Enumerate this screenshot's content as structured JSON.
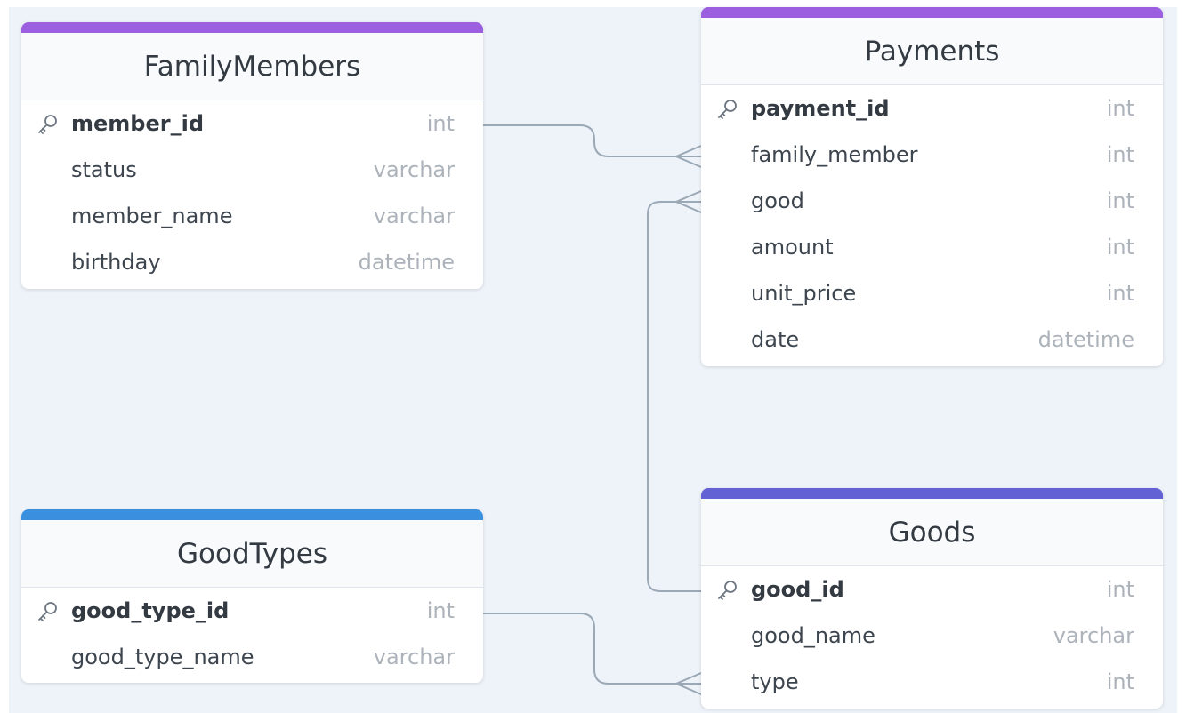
{
  "colors": {
    "family_members": "#9b5fe0",
    "payments": "#9b5fe0",
    "good_types": "#3a8fdf",
    "goods": "#6262d4",
    "edge": "#9ba8b6"
  },
  "tables": {
    "family_members": {
      "title": "FamilyMembers",
      "fields": [
        {
          "name": "member_id",
          "type": "int",
          "pk": true
        },
        {
          "name": "status",
          "type": "varchar"
        },
        {
          "name": "member_name",
          "type": "varchar"
        },
        {
          "name": "birthday",
          "type": "datetime"
        }
      ]
    },
    "payments": {
      "title": "Payments",
      "fields": [
        {
          "name": "payment_id",
          "type": "int",
          "pk": true
        },
        {
          "name": "family_member",
          "type": "int"
        },
        {
          "name": "good",
          "type": "int"
        },
        {
          "name": "amount",
          "type": "int"
        },
        {
          "name": "unit_price",
          "type": "int"
        },
        {
          "name": "date",
          "type": "datetime"
        }
      ]
    },
    "good_types": {
      "title": "GoodTypes",
      "fields": [
        {
          "name": "good_type_id",
          "type": "int",
          "pk": true
        },
        {
          "name": "good_type_name",
          "type": "varchar"
        }
      ]
    },
    "goods": {
      "title": "Goods",
      "fields": [
        {
          "name": "good_id",
          "type": "int",
          "pk": true
        },
        {
          "name": "good_name",
          "type": "varchar"
        },
        {
          "name": "type",
          "type": "int"
        }
      ]
    }
  },
  "relationships": [
    {
      "from": "FamilyMembers.member_id",
      "to": "Payments.family_member",
      "cardinality": "one-to-many"
    },
    {
      "from": "Goods.good_id",
      "to": "Payments.good",
      "cardinality": "one-to-many"
    },
    {
      "from": "GoodTypes.good_type_id",
      "to": "Goods.type",
      "cardinality": "one-to-many"
    }
  ]
}
